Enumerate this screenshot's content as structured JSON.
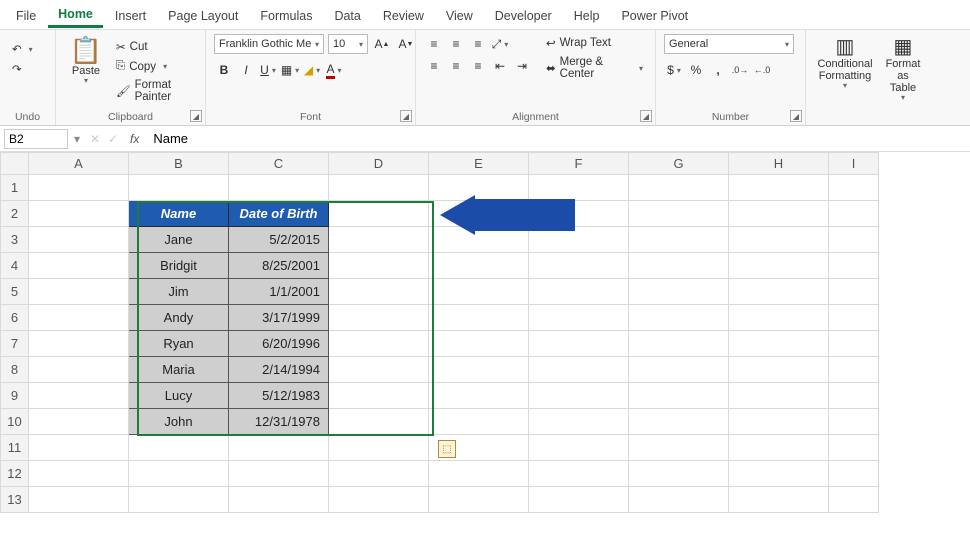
{
  "tabs": {
    "file": "File",
    "home": "Home",
    "insert": "Insert",
    "pagelayout": "Page Layout",
    "formulas": "Formulas",
    "data": "Data",
    "review": "Review",
    "view": "View",
    "developer": "Developer",
    "help": "Help",
    "powerpivot": "Power Pivot"
  },
  "ribbon": {
    "undo": {
      "label": "Undo"
    },
    "clipboard": {
      "label": "Clipboard",
      "paste": "Paste",
      "cut": "Cut",
      "copy": "Copy",
      "format_painter": "Format Painter"
    },
    "font": {
      "label": "Font",
      "name": "Franklin Gothic Me",
      "size": "10"
    },
    "alignment": {
      "label": "Alignment",
      "wrap": "Wrap Text",
      "merge": "Merge & Center"
    },
    "number": {
      "label": "Number",
      "format": "General"
    },
    "styles": {
      "cond": "Conditional\nFormatting",
      "table": "Format as\nTable"
    }
  },
  "formula_bar": {
    "cell_ref": "B2",
    "value": "Name"
  },
  "columns": [
    "A",
    "B",
    "C",
    "D",
    "E",
    "F",
    "G",
    "H",
    "I"
  ],
  "rows": [
    "1",
    "2",
    "3",
    "4",
    "5",
    "6",
    "7",
    "8",
    "9",
    "10",
    "11",
    "12",
    "13"
  ],
  "table": {
    "header_name": "Name",
    "header_dob": "Date of Birth",
    "rows": [
      {
        "name": "Jane",
        "dob": "5/2/2015"
      },
      {
        "name": "Bridgit",
        "dob": "8/25/2001"
      },
      {
        "name": "Jim",
        "dob": "1/1/2001"
      },
      {
        "name": "Andy",
        "dob": "3/17/1999"
      },
      {
        "name": "Ryan",
        "dob": "6/20/1996"
      },
      {
        "name": "Maria",
        "dob": "2/14/1994"
      },
      {
        "name": "Lucy",
        "dob": "5/12/1983"
      },
      {
        "name": "John",
        "dob": "12/31/1978"
      }
    ]
  },
  "colors": {
    "brand_green": "#107c41",
    "header_blue": "#1f5cb0",
    "arrow_blue": "#1a4ca8"
  }
}
